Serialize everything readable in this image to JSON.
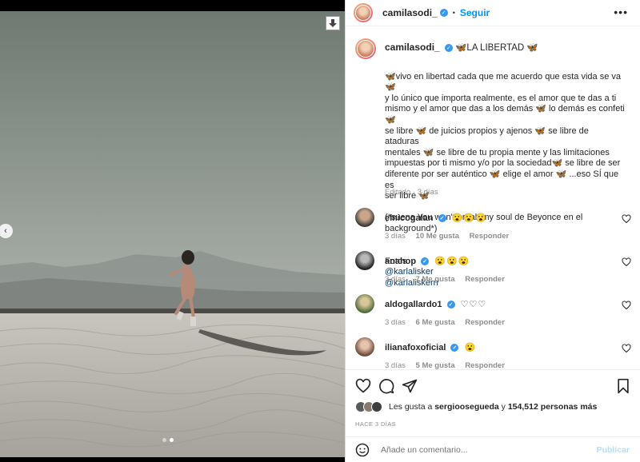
{
  "post": {
    "username": "camilasodi_",
    "follow_label": "Seguir",
    "more_label": "•••",
    "caption_title": "🦋LA LIBERTAD 🦋",
    "caption_body": "🦋vivo en libertad cada que me acuerdo que esta vida se va 🦋\ny lo único que importa realmente, es el amor que te das a ti\nmismo y el amor que das a los demás 🦋 lo demás es confeti 🦋\nse libre 🦋 de juicios propios y ajenos 🦋 se libre de ataduras\nmentales 🦋 se libre de tu propia mente y las limitaciones\nimpuestas por ti mismo y/o por la sociedad🦋 se libre de ser\ndiferente por ser auténtico 🦋 elige el amor 🦋 ...eso SÍ que es\nser libre 🦋\n\n(*suena You won't break my soul de Beyonce en el background*)",
    "caption_photos_prefix": "Fotos",
    "mention_1": "@karlalisker",
    "mention_2": "@karlaliskerrr",
    "edited_label": "Editado",
    "edited_time": "3 días"
  },
  "comments": [
    {
      "user": "elnicogalan",
      "text": "😮😮😮",
      "time": "3 días",
      "likes": "10 Me gusta",
      "reply": "Responder"
    },
    {
      "user": "anahop",
      "text": "😮😮😮",
      "time": "3 días",
      "likes": "7 Me gusta",
      "reply": "Responder"
    },
    {
      "user": "aldogallardo1",
      "text": "♡♡♡",
      "time": "3 días",
      "likes": "6 Me gusta",
      "reply": "Responder"
    },
    {
      "user": "ilianafoxoficial",
      "text": "😮",
      "time": "3 días",
      "likes": "5 Me gusta",
      "reply": "Responder"
    }
  ],
  "likes": {
    "prefix": "Les gusta a",
    "user": "sergioosegueda",
    "conj": "y",
    "count": "154,512 personas más"
  },
  "ago_label": "HACE 3 DÍAS",
  "add_comment": {
    "placeholder": "Añade un comentario...",
    "post_label": "Publicar"
  },
  "carousel": {
    "total": 2,
    "current": 2
  },
  "colors": {
    "accent": "#0095f6",
    "verified": "#3897f0",
    "link": "#00376b"
  },
  "icons": [
    "download-icon",
    "chevron-left-icon",
    "verified-icon",
    "more-icon",
    "heart-icon",
    "comment-icon",
    "share-icon",
    "save-icon",
    "emoji-icon"
  ]
}
